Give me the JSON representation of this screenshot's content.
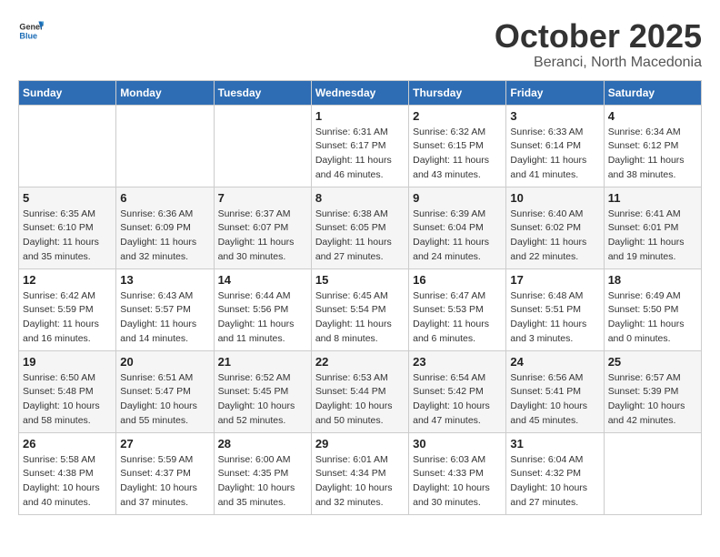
{
  "header": {
    "logo_general": "General",
    "logo_blue": "Blue",
    "title": "October 2025",
    "subtitle": "Beranci, North Macedonia"
  },
  "weekdays": [
    "Sunday",
    "Monday",
    "Tuesday",
    "Wednesday",
    "Thursday",
    "Friday",
    "Saturday"
  ],
  "weeks": [
    [
      {
        "day": "",
        "info": ""
      },
      {
        "day": "",
        "info": ""
      },
      {
        "day": "",
        "info": ""
      },
      {
        "day": "1",
        "info": "Sunrise: 6:31 AM\nSunset: 6:17 PM\nDaylight: 11 hours\nand 46 minutes."
      },
      {
        "day": "2",
        "info": "Sunrise: 6:32 AM\nSunset: 6:15 PM\nDaylight: 11 hours\nand 43 minutes."
      },
      {
        "day": "3",
        "info": "Sunrise: 6:33 AM\nSunset: 6:14 PM\nDaylight: 11 hours\nand 41 minutes."
      },
      {
        "day": "4",
        "info": "Sunrise: 6:34 AM\nSunset: 6:12 PM\nDaylight: 11 hours\nand 38 minutes."
      }
    ],
    [
      {
        "day": "5",
        "info": "Sunrise: 6:35 AM\nSunset: 6:10 PM\nDaylight: 11 hours\nand 35 minutes."
      },
      {
        "day": "6",
        "info": "Sunrise: 6:36 AM\nSunset: 6:09 PM\nDaylight: 11 hours\nand 32 minutes."
      },
      {
        "day": "7",
        "info": "Sunrise: 6:37 AM\nSunset: 6:07 PM\nDaylight: 11 hours\nand 30 minutes."
      },
      {
        "day": "8",
        "info": "Sunrise: 6:38 AM\nSunset: 6:05 PM\nDaylight: 11 hours\nand 27 minutes."
      },
      {
        "day": "9",
        "info": "Sunrise: 6:39 AM\nSunset: 6:04 PM\nDaylight: 11 hours\nand 24 minutes."
      },
      {
        "day": "10",
        "info": "Sunrise: 6:40 AM\nSunset: 6:02 PM\nDaylight: 11 hours\nand 22 minutes."
      },
      {
        "day": "11",
        "info": "Sunrise: 6:41 AM\nSunset: 6:01 PM\nDaylight: 11 hours\nand 19 minutes."
      }
    ],
    [
      {
        "day": "12",
        "info": "Sunrise: 6:42 AM\nSunset: 5:59 PM\nDaylight: 11 hours\nand 16 minutes."
      },
      {
        "day": "13",
        "info": "Sunrise: 6:43 AM\nSunset: 5:57 PM\nDaylight: 11 hours\nand 14 minutes."
      },
      {
        "day": "14",
        "info": "Sunrise: 6:44 AM\nSunset: 5:56 PM\nDaylight: 11 hours\nand 11 minutes."
      },
      {
        "day": "15",
        "info": "Sunrise: 6:45 AM\nSunset: 5:54 PM\nDaylight: 11 hours\nand 8 minutes."
      },
      {
        "day": "16",
        "info": "Sunrise: 6:47 AM\nSunset: 5:53 PM\nDaylight: 11 hours\nand 6 minutes."
      },
      {
        "day": "17",
        "info": "Sunrise: 6:48 AM\nSunset: 5:51 PM\nDaylight: 11 hours\nand 3 minutes."
      },
      {
        "day": "18",
        "info": "Sunrise: 6:49 AM\nSunset: 5:50 PM\nDaylight: 11 hours\nand 0 minutes."
      }
    ],
    [
      {
        "day": "19",
        "info": "Sunrise: 6:50 AM\nSunset: 5:48 PM\nDaylight: 10 hours\nand 58 minutes."
      },
      {
        "day": "20",
        "info": "Sunrise: 6:51 AM\nSunset: 5:47 PM\nDaylight: 10 hours\nand 55 minutes."
      },
      {
        "day": "21",
        "info": "Sunrise: 6:52 AM\nSunset: 5:45 PM\nDaylight: 10 hours\nand 52 minutes."
      },
      {
        "day": "22",
        "info": "Sunrise: 6:53 AM\nSunset: 5:44 PM\nDaylight: 10 hours\nand 50 minutes."
      },
      {
        "day": "23",
        "info": "Sunrise: 6:54 AM\nSunset: 5:42 PM\nDaylight: 10 hours\nand 47 minutes."
      },
      {
        "day": "24",
        "info": "Sunrise: 6:56 AM\nSunset: 5:41 PM\nDaylight: 10 hours\nand 45 minutes."
      },
      {
        "day": "25",
        "info": "Sunrise: 6:57 AM\nSunset: 5:39 PM\nDaylight: 10 hours\nand 42 minutes."
      }
    ],
    [
      {
        "day": "26",
        "info": "Sunrise: 5:58 AM\nSunset: 4:38 PM\nDaylight: 10 hours\nand 40 minutes."
      },
      {
        "day": "27",
        "info": "Sunrise: 5:59 AM\nSunset: 4:37 PM\nDaylight: 10 hours\nand 37 minutes."
      },
      {
        "day": "28",
        "info": "Sunrise: 6:00 AM\nSunset: 4:35 PM\nDaylight: 10 hours\nand 35 minutes."
      },
      {
        "day": "29",
        "info": "Sunrise: 6:01 AM\nSunset: 4:34 PM\nDaylight: 10 hours\nand 32 minutes."
      },
      {
        "day": "30",
        "info": "Sunrise: 6:03 AM\nSunset: 4:33 PM\nDaylight: 10 hours\nand 30 minutes."
      },
      {
        "day": "31",
        "info": "Sunrise: 6:04 AM\nSunset: 4:32 PM\nDaylight: 10 hours\nand 27 minutes."
      },
      {
        "day": "",
        "info": ""
      }
    ]
  ]
}
